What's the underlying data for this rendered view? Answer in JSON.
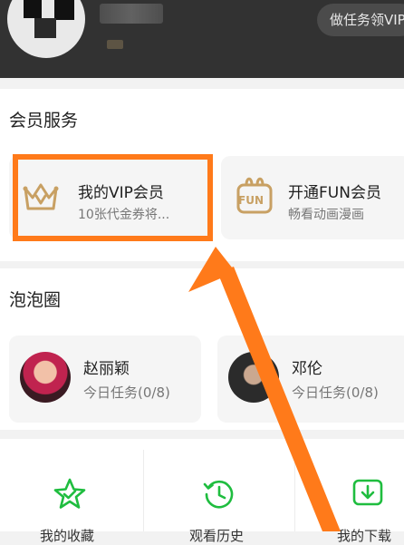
{
  "header": {
    "task_button": "做任务领VIP"
  },
  "member_service": {
    "title": "会员服务",
    "my_vip": {
      "title": "我的VIP会员",
      "subtitle": "10张代金券将..."
    },
    "fun_vip": {
      "title": "开通FUN会员",
      "subtitle": "畅看动画漫画",
      "icon_text": "FUN"
    }
  },
  "bubble_circle": {
    "title": "泡泡圈",
    "stars": [
      {
        "name": "赵丽颖",
        "task": "今日任务(0/8)"
      },
      {
        "name": "邓伦",
        "task": "今日任务(0/8)"
      }
    ]
  },
  "bottom_items": [
    {
      "label": "我的收藏"
    },
    {
      "label": "观看历史"
    },
    {
      "label": "我的下载"
    }
  ],
  "colors": {
    "accent_gold": "#c8a063",
    "accent_green": "#1fbd3f",
    "highlight_orange": "#ff7a1a"
  }
}
